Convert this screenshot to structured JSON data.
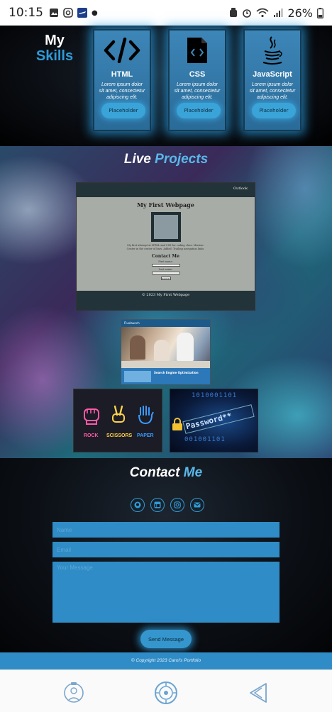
{
  "status_bar": {
    "time": "10:15",
    "battery": "26%"
  },
  "skills": {
    "title_white": "My",
    "title_blue": "Skills",
    "cards": [
      {
        "name": "HTML",
        "desc": "Lorem ipsum dolor sit amet, consectetur adipiscing elit.",
        "button": "Placeholder",
        "icon": "code-icon"
      },
      {
        "name": "CSS",
        "desc": "Lorem ipsum dolor sit amet, consectetur adipiscing elit.",
        "button": "Placeholder",
        "icon": "css-file-icon"
      },
      {
        "name": "JavaScript",
        "desc": "Lorem ipsum dolor sit amet, consectetur adipiscing elit.",
        "button": "Placeholder",
        "icon": "java-cup-icon"
      }
    ]
  },
  "projects": {
    "title_white": "Live",
    "title_blue": "Projects",
    "webpage": {
      "nav": "Outlook",
      "heading": "My First Webpage",
      "paragraph": "My first attempt at HTML and CSS for coding class. Mission: Center in the center of bars. Added: Trailing navigation links.",
      "contact_heading": "Contact Me",
      "first_label": "First name:",
      "last_label": "Last name:",
      "submit": "Submit",
      "footer": "© 2023 My First Webpage"
    },
    "seo_site": {
      "brand": "Fluxlaunch",
      "headline": "Search Engine Optimization"
    },
    "game": {
      "rock": "ROCK",
      "scissors": "SCISSORS",
      "paper": "PAPER"
    },
    "password": {
      "word": "Password**",
      "digits_top": "1010001101",
      "digits_bottom": "001001101"
    }
  },
  "contact": {
    "title_white": "Contact",
    "title_blue": "Me",
    "socials": [
      "github-icon",
      "linkedin-icon",
      "instagram-icon",
      "email-icon"
    ],
    "name_placeholder": "Name",
    "email_placeholder": "Email",
    "message_placeholder": "Your Message",
    "send": "Send Message"
  },
  "footer": {
    "copyright": "© Copyright 2023 Carol's Portfolio"
  },
  "colors": {
    "accent": "#2f8cc6",
    "glow": "#28a0e6",
    "card": "#3d86b8",
    "dark": "#0a0d12"
  }
}
